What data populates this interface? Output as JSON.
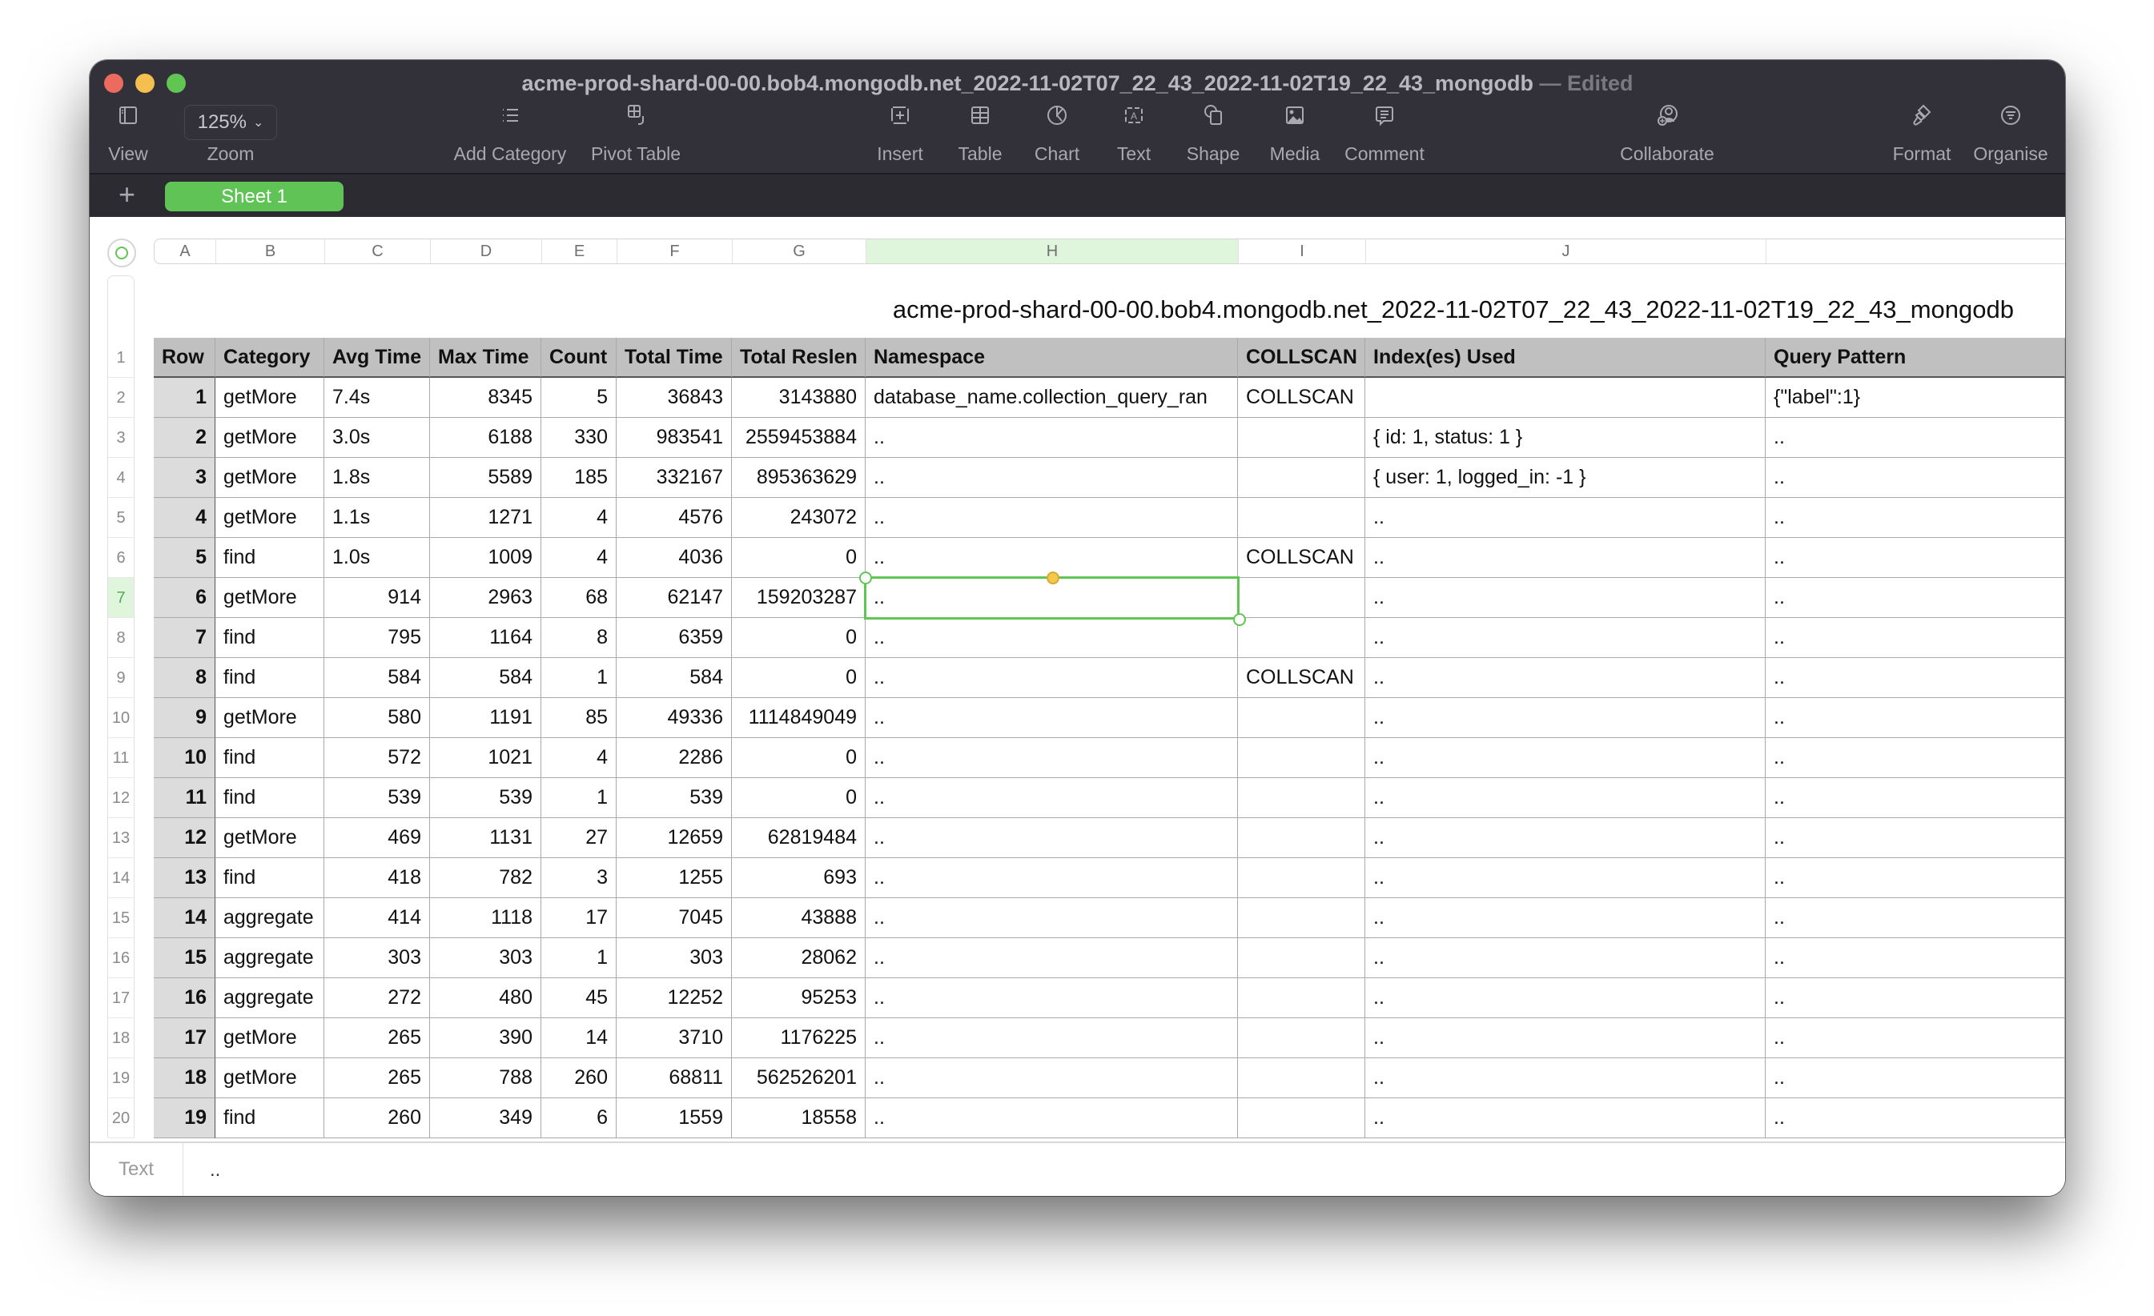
{
  "window": {
    "title": "acme-prod-shard-00-00.bob4.mongodb.net_2022-11-02T07_22_43_2022-11-02T19_22_43_mongodb",
    "title_separator": "—",
    "status": "Edited"
  },
  "toolbar": {
    "view": "View",
    "zoom_value": "125%",
    "zoom": "Zoom",
    "add_category": "Add Category",
    "pivot_table": "Pivot Table",
    "insert": "Insert",
    "table": "Table",
    "chart": "Chart",
    "text": "Text",
    "shape": "Shape",
    "media": "Media",
    "comment": "Comment",
    "collaborate": "Collaborate",
    "format": "Format",
    "organise": "Organise"
  },
  "sheets": {
    "add": "+",
    "tabs": [
      {
        "label": "Sheet 1",
        "active": true
      }
    ]
  },
  "colors": {
    "accent": "#61c554",
    "header_bg": "#bfc0bf",
    "titlebar_bg": "#32313a"
  },
  "column_letters": [
    "A",
    "B",
    "C",
    "D",
    "E",
    "F",
    "G",
    "H",
    "I",
    "J",
    ""
  ],
  "selected_column": "H",
  "selected_row": 7,
  "table": {
    "title": "acme-prod-shard-00-00.bob4.mongodb.net_2022-11-02T07_22_43_2022-11-02T19_22_43_mongodb",
    "headers": [
      "Row",
      "Category",
      "Avg Time",
      "Max Time",
      "Count",
      "Total Time",
      "Total Reslen",
      "Namespace",
      "COLLSCAN",
      "Index(es) Used",
      "Query Pattern"
    ],
    "rows": [
      [
        "1",
        "getMore",
        "7.4s",
        "8345",
        "5",
        "36843",
        "3143880",
        "database_name.collection_query_ran",
        "COLLSCAN",
        "",
        "{\"label\":1}"
      ],
      [
        "2",
        "getMore",
        "3.0s",
        "6188",
        "330",
        "983541",
        "2559453884",
        "..",
        "",
        "{ id: 1, status: 1 }",
        ".."
      ],
      [
        "3",
        "getMore",
        "1.8s",
        "5589",
        "185",
        "332167",
        "895363629",
        "..",
        "",
        "{ user: 1, logged_in: -1 }",
        ".."
      ],
      [
        "4",
        "getMore",
        "1.1s",
        "1271",
        "4",
        "4576",
        "243072",
        "..",
        "",
        "..",
        ".."
      ],
      [
        "5",
        "find",
        "1.0s",
        "1009",
        "4",
        "4036",
        "0",
        "..",
        "COLLSCAN",
        "..",
        ".."
      ],
      [
        "6",
        "getMore",
        "914",
        "2963",
        "68",
        "62147",
        "159203287",
        "..",
        "",
        "..",
        ".."
      ],
      [
        "7",
        "find",
        "795",
        "1164",
        "8",
        "6359",
        "0",
        "..",
        "",
        "..",
        ".."
      ],
      [
        "8",
        "find",
        "584",
        "584",
        "1",
        "584",
        "0",
        "..",
        "COLLSCAN",
        "..",
        ".."
      ],
      [
        "9",
        "getMore",
        "580",
        "1191",
        "85",
        "49336",
        "1114849049",
        "..",
        "",
        "..",
        ".."
      ],
      [
        "10",
        "find",
        "572",
        "1021",
        "4",
        "2286",
        "0",
        "..",
        "",
        "..",
        ".."
      ],
      [
        "11",
        "find",
        "539",
        "539",
        "1",
        "539",
        "0",
        "..",
        "",
        "..",
        ".."
      ],
      [
        "12",
        "getMore",
        "469",
        "1131",
        "27",
        "12659",
        "62819484",
        "..",
        "",
        "..",
        ".."
      ],
      [
        "13",
        "find",
        "418",
        "782",
        "3",
        "1255",
        "693",
        "..",
        "",
        "..",
        ".."
      ],
      [
        "14",
        "aggregate",
        "414",
        "1118",
        "17",
        "7045",
        "43888",
        "..",
        "",
        "..",
        ".."
      ],
      [
        "15",
        "aggregate",
        "303",
        "303",
        "1",
        "303",
        "28062",
        "..",
        "",
        "..",
        ".."
      ],
      [
        "16",
        "aggregate",
        "272",
        "480",
        "45",
        "12252",
        "95253",
        "..",
        "",
        "..",
        ".."
      ],
      [
        "17",
        "getMore",
        "265",
        "390",
        "14",
        "3710",
        "1176225",
        "..",
        "",
        "..",
        ".."
      ],
      [
        "18",
        "getMore",
        "265",
        "788",
        "260",
        "68811",
        "562526201",
        "..",
        "",
        "..",
        ".."
      ],
      [
        "19",
        "find",
        "260",
        "349",
        "6",
        "1559",
        "18558",
        "..",
        "",
        "..",
        ".."
      ]
    ]
  },
  "formula_bar": {
    "label": "Text",
    "value": ".."
  }
}
